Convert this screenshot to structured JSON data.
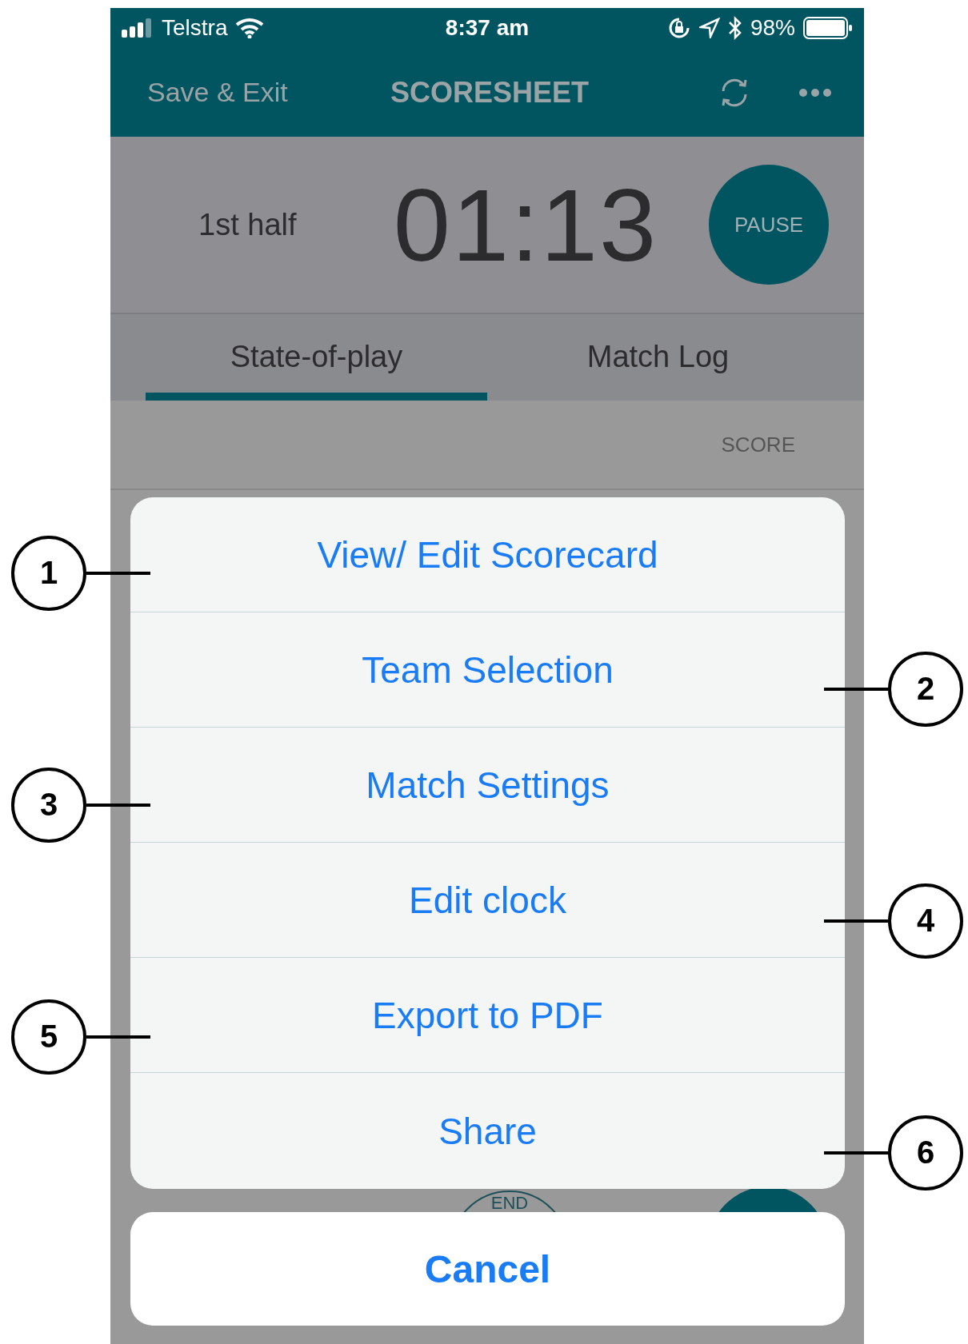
{
  "status_bar": {
    "carrier": "Telstra",
    "time": "8:37 am",
    "battery": "98%"
  },
  "nav": {
    "left": "Save & Exit",
    "title": "SCORESHEET"
  },
  "timer": {
    "period": "1st half",
    "clock": "01:13",
    "button": "PAUSE"
  },
  "tabs": [
    {
      "label": "State-of-play",
      "selected": true
    },
    {
      "label": "Match Log",
      "selected": false
    }
  ],
  "score_header": "SCORE",
  "background_button": "END",
  "action_sheet": {
    "items": [
      "View/ Edit Scorecard",
      "Team Selection",
      "Match Settings",
      "Edit clock",
      "Export to PDF",
      "Share"
    ],
    "cancel": "Cancel"
  },
  "callouts": [
    {
      "number": "1",
      "kind": "left"
    },
    {
      "number": "2",
      "kind": "right"
    },
    {
      "number": "3",
      "kind": "left"
    },
    {
      "number": "4",
      "kind": "right"
    },
    {
      "number": "5",
      "kind": "left"
    },
    {
      "number": "6",
      "kind": "right"
    }
  ]
}
